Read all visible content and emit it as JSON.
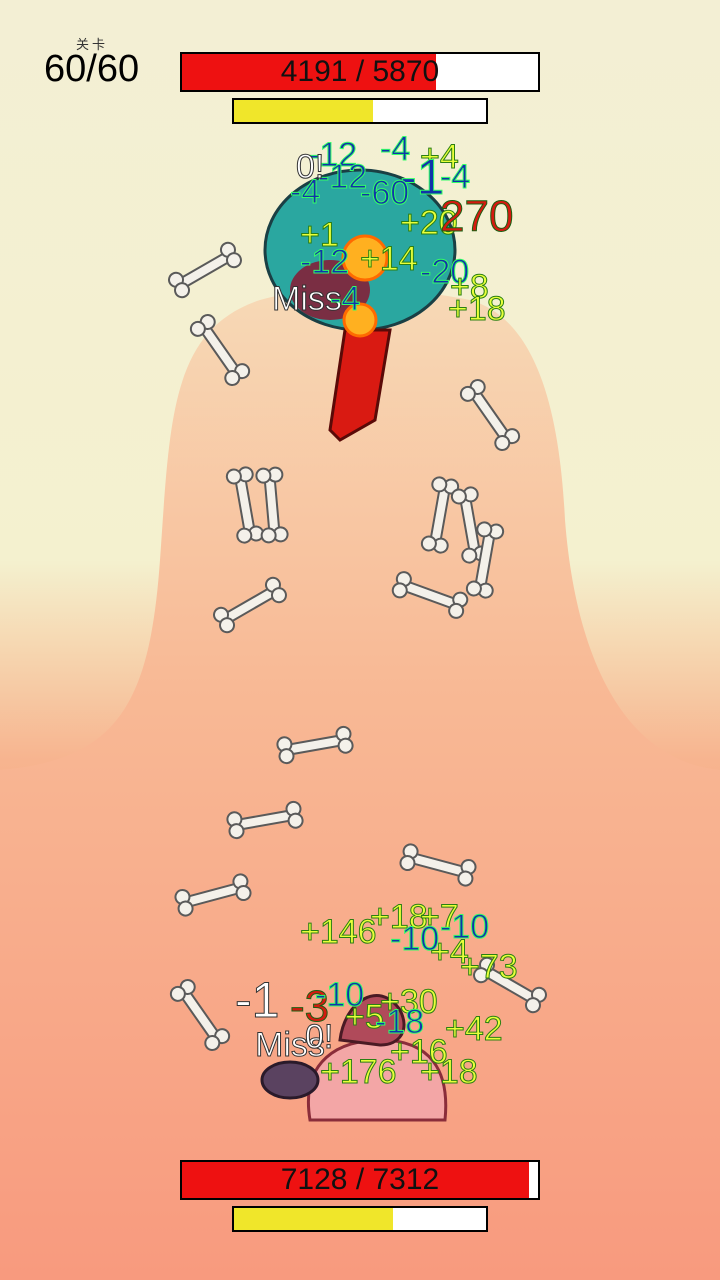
{
  "hud": {
    "level_caption": "关卡",
    "level_value": "60/60"
  },
  "enemy": {
    "hp_text": "4191 / 5870",
    "hp": 4191,
    "hp_max": 5870,
    "energy_fraction": 0.55
  },
  "player": {
    "hp_text": "7128 / 7312",
    "hp": 7128,
    "hp_max": 7312,
    "energy_fraction": 0.63
  },
  "enemy_popups": [
    {
      "text": "-12",
      "style": "blue"
    },
    {
      "text": "-4",
      "style": "blue"
    },
    {
      "text": "+4",
      "style": "yellow"
    },
    {
      "text": "-12",
      "style": "blue"
    },
    {
      "text": "-1",
      "style": "blue"
    },
    {
      "text": "-4",
      "style": "blue"
    },
    {
      "text": "0!",
      "style": "white"
    },
    {
      "text": "-4",
      "style": "blue"
    },
    {
      "text": "-60",
      "style": "blue"
    },
    {
      "text": "+1",
      "style": "yellow"
    },
    {
      "text": "+20",
      "style": "yellow"
    },
    {
      "text": "270",
      "style": "red"
    },
    {
      "text": "-12",
      "style": "blue"
    },
    {
      "text": "+14",
      "style": "yellow"
    },
    {
      "text": "-20",
      "style": "blue"
    },
    {
      "text": "Miss",
      "style": "white"
    },
    {
      "text": "-4",
      "style": "blue"
    },
    {
      "text": "+8",
      "style": "yellow"
    },
    {
      "text": "+18",
      "style": "yellow"
    }
  ],
  "player_popups": [
    {
      "text": "+18",
      "style": "yellow"
    },
    {
      "text": "+7",
      "style": "yellow"
    },
    {
      "text": "-10",
      "style": "blue"
    },
    {
      "text": "+146",
      "style": "yellow"
    },
    {
      "text": "-10",
      "style": "blue"
    },
    {
      "text": "+4",
      "style": "yellow"
    },
    {
      "text": "+73",
      "style": "yellow"
    },
    {
      "text": "-1",
      "style": "white"
    },
    {
      "text": "-3",
      "style": "red"
    },
    {
      "text": "-10",
      "style": "blue"
    },
    {
      "text": "+30",
      "style": "yellow"
    },
    {
      "text": "Miss",
      "style": "white"
    },
    {
      "text": "+5",
      "style": "yellow"
    },
    {
      "text": "-18",
      "style": "blue"
    },
    {
      "text": "+42",
      "style": "yellow"
    },
    {
      "text": "0!",
      "style": "white"
    },
    {
      "text": "+16",
      "style": "yellow"
    },
    {
      "text": "+176",
      "style": "yellow"
    },
    {
      "text": "+18",
      "style": "yellow"
    }
  ],
  "colors": {
    "hp": "#ee1111",
    "energy": "#f0e62a",
    "sky": "#f3efd4",
    "ground": "#f89a7e"
  }
}
